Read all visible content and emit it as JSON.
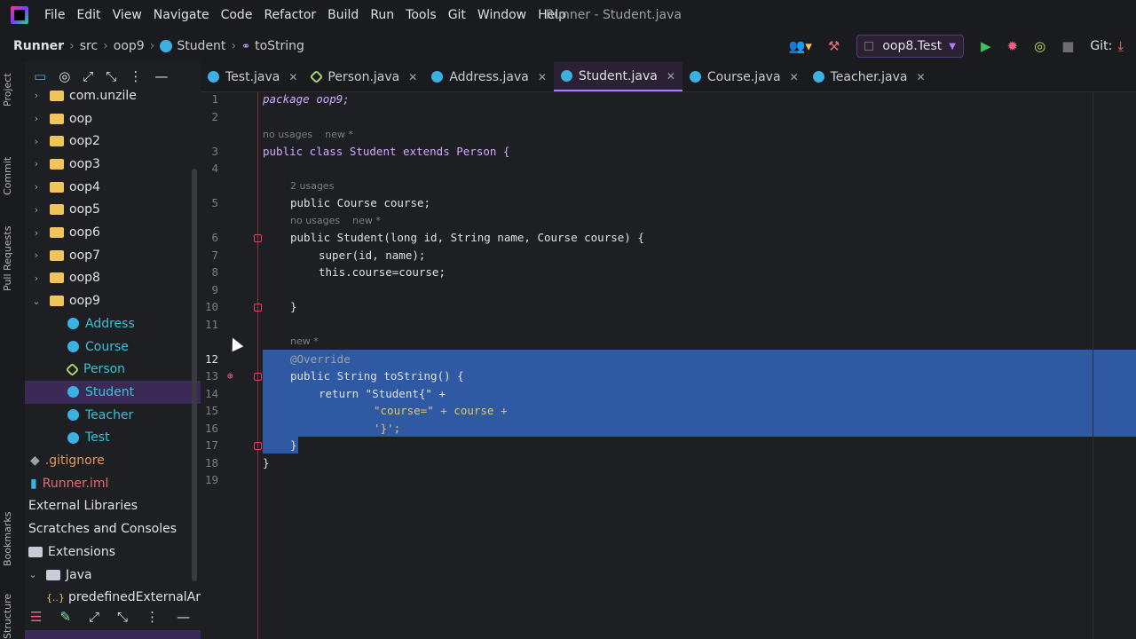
{
  "window": {
    "title": "Runner - Student.java"
  },
  "menu": [
    "File",
    "Edit",
    "View",
    "Navigate",
    "Code",
    "Refactor",
    "Build",
    "Run",
    "Tools",
    "Git",
    "Window",
    "Help"
  ],
  "breadcrumb": {
    "project": "Runner",
    "src": "src",
    "package": "oop9",
    "class": "Student",
    "method": "toString"
  },
  "toolbar": {
    "run_config": "oop8.Test",
    "git_label": "Git:"
  },
  "left_strip": [
    "Project",
    "Commit",
    "Pull Requests",
    "Bookmarks",
    "Structure"
  ],
  "tree": [
    {
      "label": "com.unzile",
      "kind": "folder"
    },
    {
      "label": "oop",
      "kind": "folder"
    },
    {
      "label": "oop2",
      "kind": "folder"
    },
    {
      "label": "oop3",
      "kind": "folder"
    },
    {
      "label": "oop4",
      "kind": "folder"
    },
    {
      "label": "oop5",
      "kind": "folder"
    },
    {
      "label": "oop6",
      "kind": "folder"
    },
    {
      "label": "oop7",
      "kind": "folder"
    },
    {
      "label": "oop8",
      "kind": "folder"
    },
    {
      "label": "oop9",
      "kind": "folder-open"
    },
    {
      "label": "Address",
      "kind": "class"
    },
    {
      "label": "Course",
      "kind": "class"
    },
    {
      "label": "Person",
      "kind": "abstract"
    },
    {
      "label": "Student",
      "kind": "class",
      "selected": true
    },
    {
      "label": "Teacher",
      "kind": "class"
    },
    {
      "label": "Test",
      "kind": "class"
    },
    {
      "label": ".gitignore",
      "kind": "gitignore"
    },
    {
      "label": "Runner.iml",
      "kind": "iml"
    },
    {
      "label": "External Libraries",
      "kind": "root"
    },
    {
      "label": "Scratches and Consoles",
      "kind": "root"
    },
    {
      "label": "Extensions",
      "kind": "grey-folder"
    },
    {
      "label": "Java",
      "kind": "grey-folder-open"
    },
    {
      "label": "predefinedExternalAr",
      "kind": "item"
    }
  ],
  "tabs": [
    {
      "label": "Test.java",
      "kind": "class"
    },
    {
      "label": "Person.java",
      "kind": "abstract"
    },
    {
      "label": "Address.java",
      "kind": "class"
    },
    {
      "label": "Student.java",
      "kind": "class",
      "active": true
    },
    {
      "label": "Course.java",
      "kind": "class"
    },
    {
      "label": "Teacher.java",
      "kind": "class"
    }
  ],
  "code": {
    "line1": "package oop9;",
    "hint3": "no usages    new *",
    "line3": "public class Student extends Person {",
    "hint5": "2 usages",
    "line5": "public Course course;",
    "hint6": "no usages    new *",
    "line6": "public Student(long id, String name, Course course) {",
    "line7": "super(id, name);",
    "line8": "this.course=course;",
    "line10": "}",
    "hint12": "new *",
    "line12": "@Override",
    "line13": "public String toString() {",
    "line14": "return \"Student{\" +",
    "line15": "\"course=\" + course +",
    "line16": "'}';",
    "line17": "}",
    "line18": "}"
  },
  "line_numbers": [
    "1",
    "2",
    "3",
    "4",
    "5",
    "6",
    "7",
    "8",
    "9",
    "10",
    "11",
    "12",
    "13",
    "14",
    "15",
    "16",
    "17",
    "18",
    "19"
  ]
}
